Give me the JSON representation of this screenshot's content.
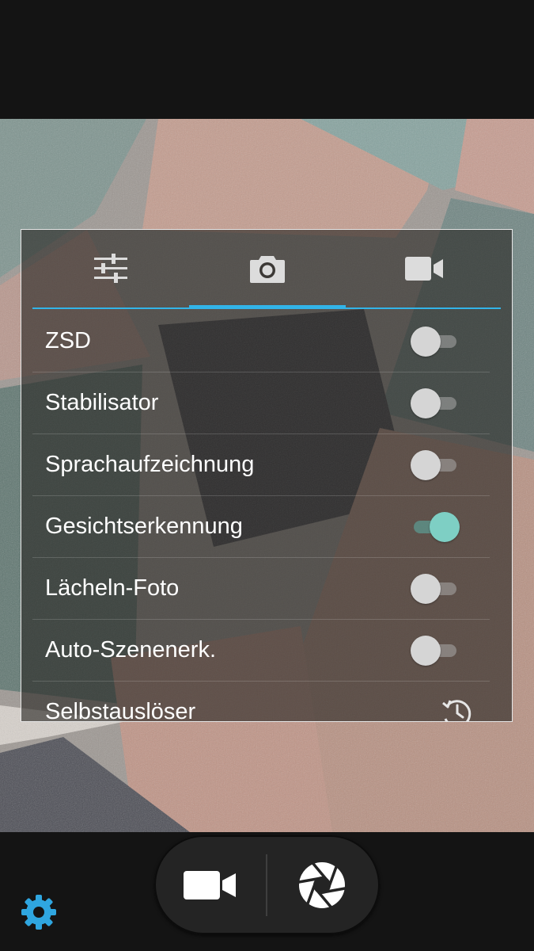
{
  "tabs": [
    {
      "name": "sliders-icon",
      "active": false
    },
    {
      "name": "camera-icon",
      "active": true
    },
    {
      "name": "videocam-icon",
      "active": false
    }
  ],
  "settings": [
    {
      "label": "ZSD",
      "control": "toggle",
      "on": false
    },
    {
      "label": "Stabilisator",
      "control": "toggle",
      "on": false
    },
    {
      "label": "Sprachaufzeichnung",
      "control": "toggle",
      "on": false
    },
    {
      "label": "Gesichtserkennung",
      "control": "toggle",
      "on": true
    },
    {
      "label": "Lächeln-Foto",
      "control": "toggle",
      "on": false
    },
    {
      "label": "Auto-Szenenerk.",
      "control": "toggle",
      "on": false
    },
    {
      "label": "Selbstauslöser",
      "control": "timer-icon"
    }
  ],
  "bottom_bar": {
    "video_mode_icon": "videocam-icon",
    "shutter_icon": "shutter-icon",
    "settings_icon": "gear-icon"
  },
  "colors": {
    "accent": "#32b4e8",
    "toggle_on": "#7ecfc4",
    "toggle_off": "#d5d5d5"
  }
}
